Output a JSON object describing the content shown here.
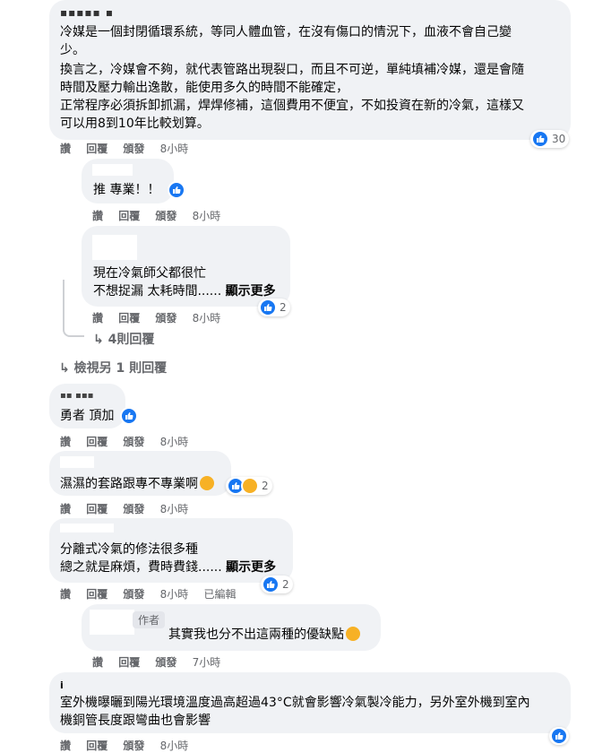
{
  "comments": [
    {
      "name": "▪▪▪▪▪ ▪",
      "lines": [
        "冷媒是一個封閉循環系統，等同人體血管，在沒有傷口的情況下，血液不會自己變",
        "少。",
        "換言之，冷媒會不夠，就代表管路出現裂口，而且不可逆，單純填補冷媒，還是會隨",
        "時間及壓力輸出逸散，能使用多久的時間不能確定，",
        "正常程序必須拆卸抓漏，焊焊修補，這個費用不便宜，不如投資在新的冷氣，這樣又",
        "可以用8到10年比較划算。"
      ],
      "reaction_count": "30",
      "actions": {
        "like": "讚",
        "reply": "回覆",
        "share": "頒發",
        "time": "8小時"
      }
    },
    {
      "text": "推 專業！！",
      "actions": {
        "like": "讚",
        "reply": "回覆",
        "share": "頒發",
        "time": "8小時"
      }
    },
    {
      "lines": [
        "現在冷氣師父都很忙",
        "不想捉漏 太耗時間......"
      ],
      "see_more": "顯示更多",
      "reaction_count": "2",
      "actions": {
        "like": "讚",
        "reply": "回覆",
        "share": "頒發",
        "time": "8小時"
      }
    },
    {
      "name": "▪▪ ▪▪▪",
      "text": "勇者 頂加",
      "actions": {
        "like": "讚",
        "reply": "回覆",
        "share": "頒發",
        "time": "8小時"
      }
    },
    {
      "text": "濕濕的套路跟專不專業啊",
      "reaction_count": "2",
      "actions": {
        "like": "讚",
        "reply": "回覆",
        "share": "頒發",
        "time": "8小時"
      }
    },
    {
      "lines": [
        "分離式冷氣的修法很多種",
        "總之就是麻煩，費時費錢......"
      ],
      "see_more": "顯示更多",
      "reaction_count": "2",
      "actions": {
        "like": "讚",
        "reply": "回覆",
        "share": "頒發",
        "time": "8小時",
        "edited": "已編輯"
      }
    },
    {
      "author_badge": "作者",
      "text": "其實我也分不出這兩種的優缺點",
      "actions": {
        "like": "讚",
        "reply": "回覆",
        "share": "頒發",
        "time": "7小時"
      }
    },
    {
      "name": "i",
      "lines": [
        "室外機曝曬到陽光環境溫度過高超過43°C就會影響冷氣製冷能力，另外室外機到室內",
        "機銅管長度跟彎曲也會影響"
      ],
      "actions": {
        "like": "讚",
        "reply": "回覆",
        "share": "頒發",
        "time": "8小時"
      }
    }
  ],
  "replies_link": "4則回覆",
  "view_more_replies": "檢視另 1 則回覆",
  "colors": {
    "bubble": "#f0f2f5",
    "like_blue": "#1877f2",
    "meta_gray": "#65676b"
  }
}
